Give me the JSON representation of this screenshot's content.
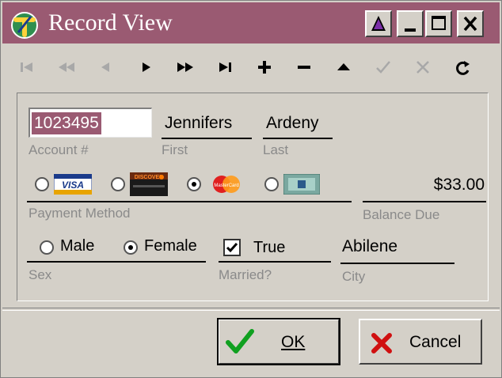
{
  "window": {
    "title": "Record View",
    "colors": {
      "titlebar": "#9a5a72",
      "face": "#d4d0c8",
      "selection": "#9a5a72"
    }
  },
  "title_buttons": [
    {
      "name": "help-icon"
    },
    {
      "name": "minimize-icon"
    },
    {
      "name": "maximize-icon"
    },
    {
      "name": "close-icon"
    }
  ],
  "navigator": {
    "buttons": [
      {
        "name": "first-record-icon",
        "enabled": false
      },
      {
        "name": "prior-page-icon",
        "enabled": false
      },
      {
        "name": "prior-record-icon",
        "enabled": false
      },
      {
        "name": "next-record-icon",
        "enabled": true
      },
      {
        "name": "next-page-icon",
        "enabled": true
      },
      {
        "name": "last-record-icon",
        "enabled": true
      },
      {
        "name": "insert-record-icon",
        "enabled": true
      },
      {
        "name": "delete-record-icon",
        "enabled": true
      },
      {
        "name": "edit-record-icon",
        "enabled": true
      },
      {
        "name": "post-edit-icon",
        "enabled": false
      },
      {
        "name": "cancel-edit-icon",
        "enabled": false
      },
      {
        "name": "refresh-icon",
        "enabled": true
      }
    ]
  },
  "record": {
    "account_number": "1023495",
    "account_caption": "Account #",
    "first_name": "Jennifers",
    "first_caption": "First",
    "last_name": "Ardeny",
    "last_caption": "Last",
    "payment_caption": "Payment Method",
    "payment_options": [
      {
        "name": "visa-card-icon",
        "label": "VISA",
        "selected": false
      },
      {
        "name": "discover-card-icon",
        "label": "DISCOVER",
        "selected": false
      },
      {
        "name": "mastercard-card-icon",
        "label": "MasterCard",
        "selected": true
      },
      {
        "name": "other-card-icon",
        "label": "",
        "selected": false
      }
    ],
    "balance_due": "$33.00",
    "balance_caption": "Balance Due",
    "sex_caption": "Sex",
    "sex_options": [
      {
        "label": "Male",
        "selected": false
      },
      {
        "label": "Female",
        "selected": true
      }
    ],
    "married_value": "True",
    "married_checked": true,
    "married_caption": "Married?",
    "city": "Abilene",
    "city_caption": "City"
  },
  "buttons": {
    "ok_label": "OK",
    "cancel_label": "Cancel"
  }
}
